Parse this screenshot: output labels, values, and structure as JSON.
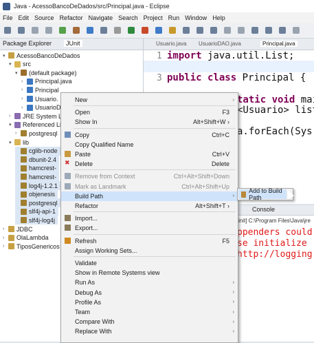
{
  "window": {
    "title": "Java - AcessoBancoDeDados/src/Principal.java - Eclipse"
  },
  "menubar": [
    "File",
    "Edit",
    "Source",
    "Refactor",
    "Navigate",
    "Search",
    "Project",
    "Run",
    "Window",
    "Help"
  ],
  "left_tabs": {
    "package_explorer": "Package Explorer",
    "junit": "JUnit"
  },
  "tree": [
    {
      "label": "AcessoBancoDeDados",
      "arrow": "▾",
      "icon": "project",
      "indent": 0
    },
    {
      "label": "src",
      "arrow": "▾",
      "icon": "folder",
      "indent": 1
    },
    {
      "label": "(default package)",
      "arrow": "▾",
      "icon": "package",
      "indent": 2
    },
    {
      "label": "Principal.java",
      "arrow": "›",
      "icon": "java",
      "indent": 3
    },
    {
      "label": "Principal",
      "arrow": "›",
      "icon": "java",
      "indent": 3
    },
    {
      "label": "Usuario.",
      "arrow": "›",
      "icon": "java",
      "indent": 3
    },
    {
      "label": "UsuarioD",
      "arrow": "›",
      "icon": "java",
      "indent": 3
    },
    {
      "label": "JRE System L",
      "arrow": "›",
      "icon": "library",
      "indent": 1
    },
    {
      "label": "Referenced Li",
      "arrow": "▾",
      "icon": "library",
      "indent": 1
    },
    {
      "label": "postgresql",
      "arrow": "›",
      "icon": "jar",
      "indent": 2
    },
    {
      "label": "lib",
      "arrow": "▾",
      "icon": "folder",
      "indent": 1
    },
    {
      "label": "cglib-node",
      "arrow": "",
      "icon": "jar",
      "indent": 2
    },
    {
      "label": "dbunit-2.4",
      "arrow": "",
      "icon": "jar",
      "indent": 2
    },
    {
      "label": "hamcrest-",
      "arrow": "",
      "icon": "jar",
      "indent": 2
    },
    {
      "label": "hamcrest-",
      "arrow": "",
      "icon": "jar",
      "indent": 2
    },
    {
      "label": "log4j-1.2.1",
      "arrow": "",
      "icon": "jar",
      "indent": 2
    },
    {
      "label": "objenesis",
      "arrow": "",
      "icon": "jar",
      "indent": 2
    },
    {
      "label": "postgresql",
      "arrow": "",
      "icon": "jar",
      "indent": 2
    },
    {
      "label": "slf4j-api-1",
      "arrow": "",
      "icon": "jar",
      "indent": 2
    },
    {
      "label": "slf4j-log4j",
      "arrow": "",
      "icon": "jar",
      "indent": 2
    },
    {
      "label": "JDBC",
      "arrow": "›",
      "icon": "project",
      "indent": 0
    },
    {
      "label": "OlaLambda",
      "arrow": "›",
      "icon": "project",
      "indent": 0
    },
    {
      "label": "TiposGenericos",
      "arrow": "›",
      "icon": "project",
      "indent": 0
    }
  ],
  "editor_tabs": [
    "Usuario.java",
    "UsuarioDAO.java",
    "Principal.java"
  ],
  "code": {
    "l1_num": "1",
    "l1_kw": "import",
    "l1_rest": " java.util.List;",
    "l2_num": "2",
    "l3_num": "3",
    "l3_kw": "public class",
    "l3_rest": " Principal {",
    "l4_kw": "tatic void",
    "l4_rest": " mai",
    "l5": "<Usuario> list",
    "l6": "a.forEach(Sys"
  },
  "console": {
    "tab": "Console",
    "header": "init] C:\\Program Files\\Java\\jre",
    "lines": [
      "ppenders could",
      "se initialize",
      "http://logging"
    ]
  },
  "context_menu": [
    {
      "label": "New",
      "shortcut": "",
      "sub": true,
      "disabled": false,
      "icon": "",
      "underline": ""
    },
    {
      "sep": true
    },
    {
      "label": "Open",
      "shortcut": "F3",
      "sub": false,
      "disabled": false,
      "icon": ""
    },
    {
      "label": "Show In",
      "shortcut": "Alt+Shift+W ›",
      "sub": false,
      "disabled": false,
      "icon": ""
    },
    {
      "sep": true
    },
    {
      "label": "Copy",
      "shortcut": "Ctrl+C",
      "sub": false,
      "disabled": false,
      "icon": "copy"
    },
    {
      "label": "Copy Qualified Name",
      "shortcut": "",
      "sub": false,
      "disabled": false,
      "icon": ""
    },
    {
      "label": "Paste",
      "shortcut": "Ctrl+V",
      "sub": false,
      "disabled": false,
      "icon": "paste"
    },
    {
      "label": "Delete",
      "shortcut": "Delete",
      "sub": false,
      "disabled": false,
      "icon": "delete"
    },
    {
      "sep": true
    },
    {
      "label": "Remove from Context",
      "shortcut": "Ctrl+Alt+Shift+Down",
      "sub": false,
      "disabled": true,
      "icon": "remove"
    },
    {
      "label": "Mark as Landmark",
      "shortcut": "Ctrl+Alt+Shift+Up",
      "sub": false,
      "disabled": true,
      "icon": "landmark"
    },
    {
      "label": "Build Path",
      "shortcut": "",
      "sub": true,
      "disabled": false,
      "icon": "",
      "selected": true
    },
    {
      "label": "Refactor",
      "shortcut": "Alt+Shift+T ›",
      "sub": false,
      "disabled": false,
      "icon": ""
    },
    {
      "sep": true
    },
    {
      "label": "Import...",
      "shortcut": "",
      "sub": false,
      "disabled": false,
      "icon": "import"
    },
    {
      "label": "Export...",
      "shortcut": "",
      "sub": false,
      "disabled": false,
      "icon": "export"
    },
    {
      "sep": true
    },
    {
      "label": "Refresh",
      "shortcut": "F5",
      "sub": false,
      "disabled": false,
      "icon": "refresh"
    },
    {
      "label": "Assign Working Sets...",
      "shortcut": "",
      "sub": false,
      "disabled": false,
      "icon": ""
    },
    {
      "sep": true
    },
    {
      "label": "Validate",
      "shortcut": "",
      "sub": false,
      "disabled": false,
      "icon": ""
    },
    {
      "label": "Show in Remote Systems view",
      "shortcut": "",
      "sub": false,
      "disabled": false,
      "icon": ""
    },
    {
      "label": "Run As",
      "shortcut": "",
      "sub": true,
      "disabled": false,
      "icon": ""
    },
    {
      "label": "Debug As",
      "shortcut": "",
      "sub": true,
      "disabled": false,
      "icon": ""
    },
    {
      "label": "Profile As",
      "shortcut": "",
      "sub": true,
      "disabled": false,
      "icon": ""
    },
    {
      "label": "Team",
      "shortcut": "",
      "sub": true,
      "disabled": false,
      "icon": ""
    },
    {
      "label": "Compare With",
      "shortcut": "",
      "sub": true,
      "disabled": false,
      "icon": ""
    },
    {
      "label": "Replace With",
      "shortcut": "",
      "sub": true,
      "disabled": false,
      "icon": ""
    }
  ],
  "submenu": {
    "label": "Add to Build Path"
  },
  "colors": {
    "selection": "#cfe3fb",
    "keyword": "#7f0055",
    "console_error": "#e01818"
  }
}
